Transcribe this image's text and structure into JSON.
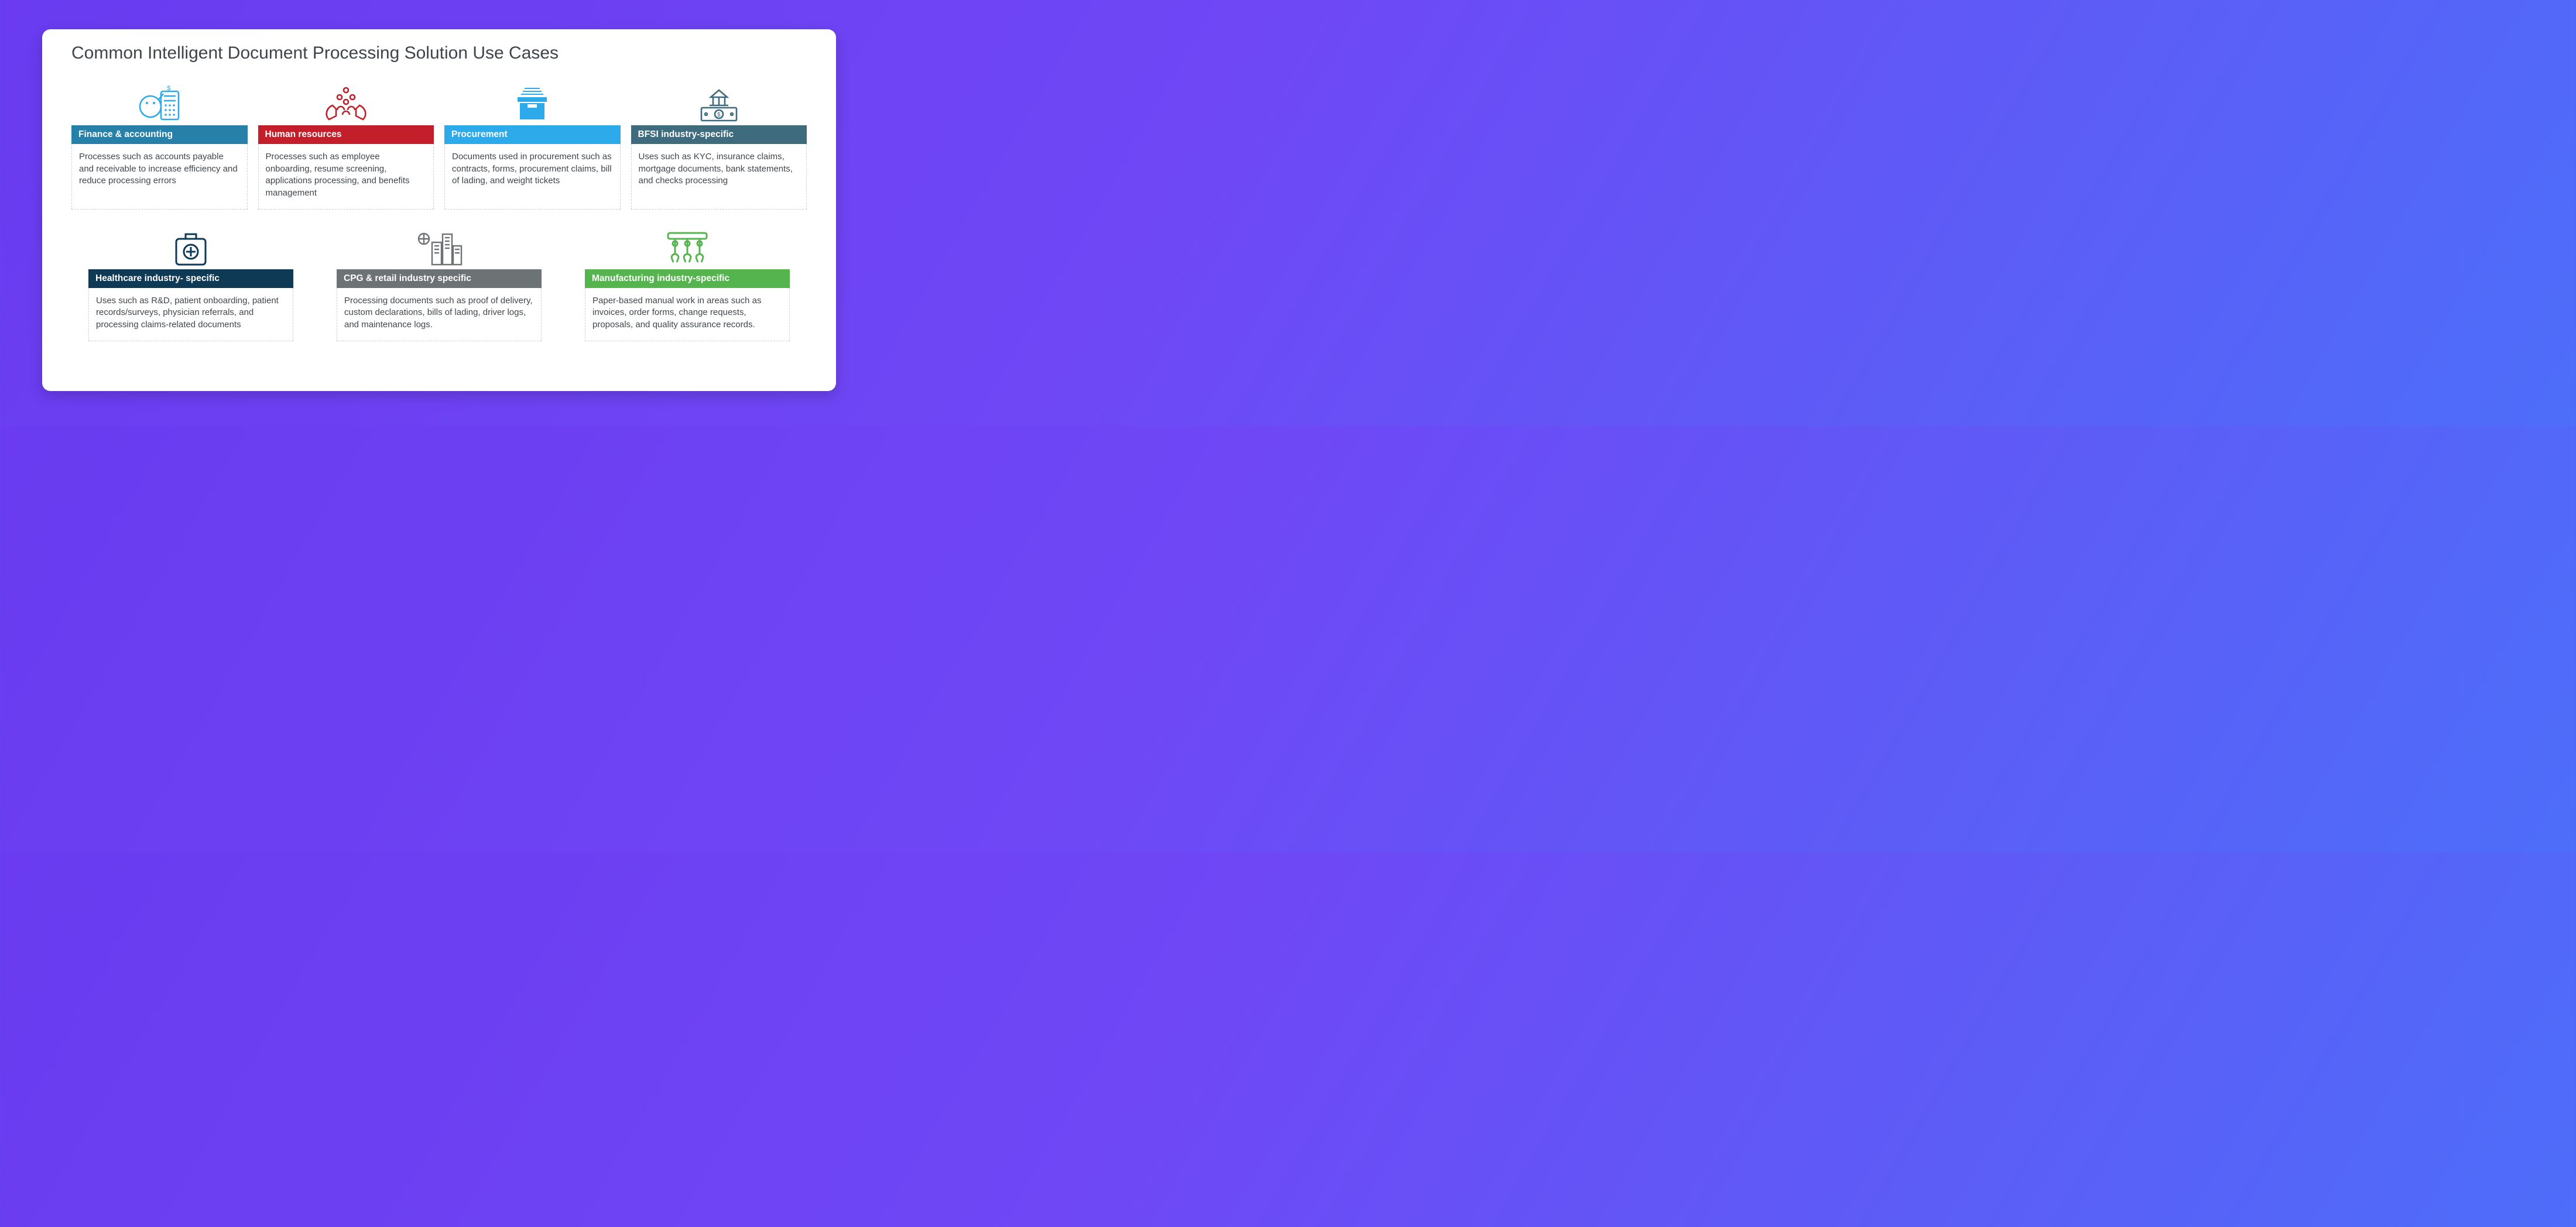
{
  "title": "Common Intelligent Document Processing Solution Use Cases",
  "cards": [
    {
      "icon": "finance-icon",
      "headerColor": "#2680a8",
      "header": "Finance & accounting",
      "body": "Processes such as accounts payable and receivable to increase efficiency and reduce processing errors"
    },
    {
      "icon": "hr-icon",
      "headerColor": "#c21f2a",
      "header": "Human resources",
      "body": "Processes such as employee onboarding, resume screening, applications processing, and benefits management"
    },
    {
      "icon": "procurement-icon",
      "headerColor": "#2daaea",
      "header": "Procurement",
      "body": "Documents used in procurement such as contracts, forms, procurement claims, bill of lading, and weight tickets"
    },
    {
      "icon": "bfsi-icon",
      "headerColor": "#3e6b7d",
      "header": "BFSI industry-specific",
      "body": "Uses such as KYC, insurance claims, mortgage documents, bank statements, and checks processing"
    },
    {
      "icon": "healthcare-icon",
      "headerColor": "#0f3a56",
      "header": "Healthcare industry- specific",
      "body": "Uses such as R&D, patient onboarding, patient records/surveys, physician referrals, and processing claims-related documents"
    },
    {
      "icon": "retail-icon",
      "headerColor": "#6d7274",
      "header": "CPG & retail industry specific",
      "body": "Processing documents such as proof of delivery, custom declarations, bills of lading, driver logs, and maintenance logs."
    },
    {
      "icon": "manufacturing-icon",
      "headerColor": "#55b44d",
      "header": "Manufacturing industry-specific",
      "body": "Paper-based manual work in areas such as invoices, order forms, change requests, proposals, and quality assurance records."
    }
  ]
}
